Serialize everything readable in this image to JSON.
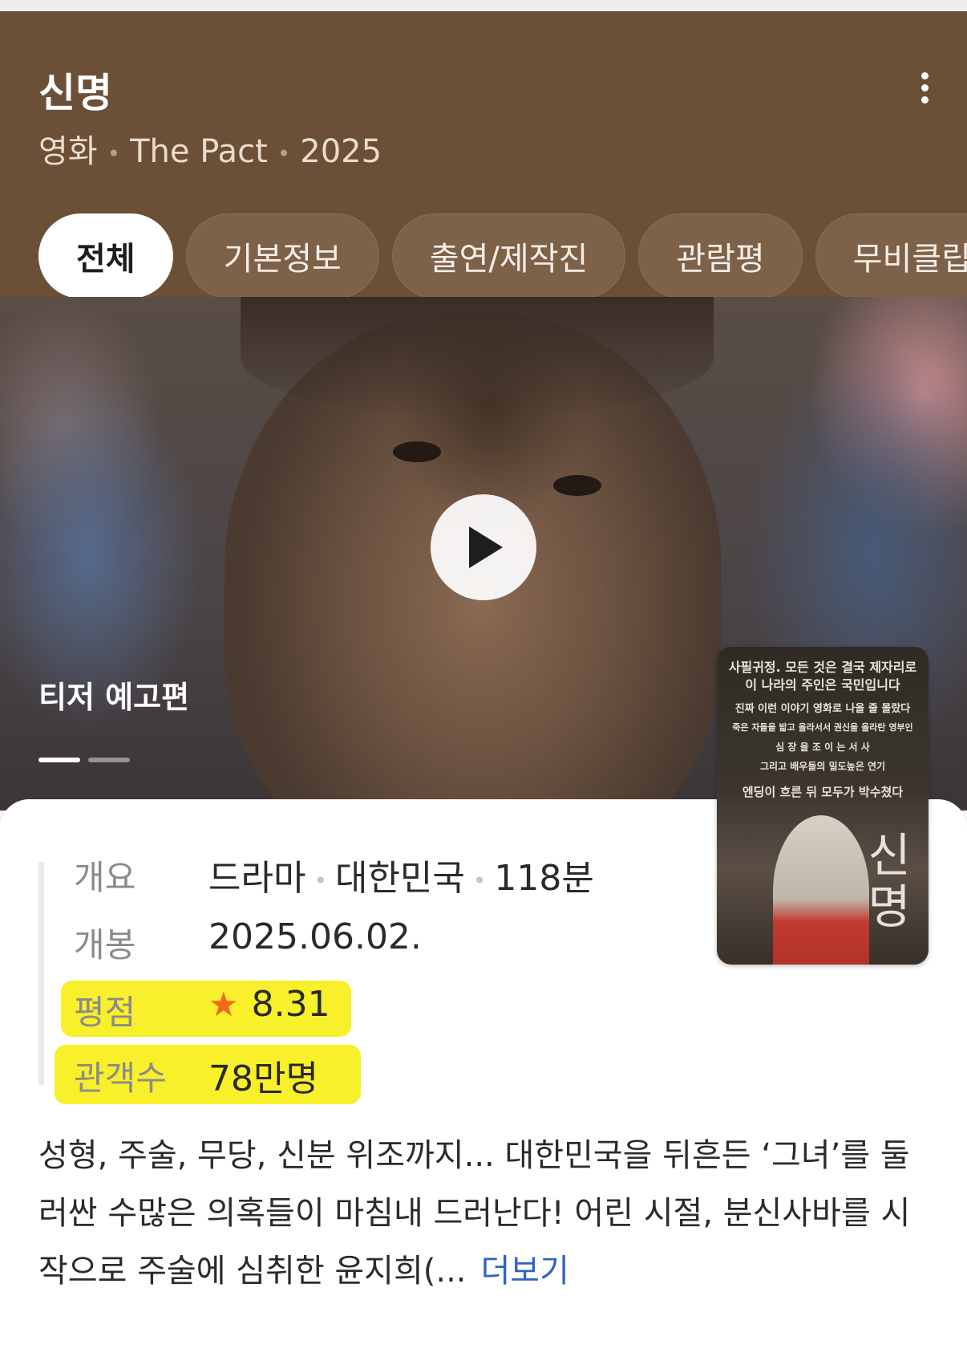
{
  "header": {
    "title": "신명",
    "subtitle_parts": [
      "영화",
      "The Pact",
      "2025"
    ]
  },
  "tabs": [
    {
      "label": "전체",
      "active": true
    },
    {
      "label": "기본정보",
      "active": false
    },
    {
      "label": "출연/제작진",
      "active": false
    },
    {
      "label": "관람평",
      "active": false
    },
    {
      "label": "무비클립",
      "active": false
    }
  ],
  "video": {
    "label": "티저 예고편",
    "slides_total": 2,
    "current_slide": 1
  },
  "poster": {
    "lines": [
      "사필귀정. 모든 것은 결국 제자리로",
      "이 나라의 주인은 국민입니다",
      "진짜 이런 이야기 영화로 나올 줄 몰랐다",
      "죽은 자들을 밟고 올라서서 권신을 올라탄 영부인",
      "심 장 을  조 이 는  서 사",
      "그리고 배우들의 밀도높은 연기",
      "엔딩이 흐른 뒤 모두가 박수쳤다"
    ],
    "title": "신명"
  },
  "info": {
    "overview": {
      "label": "개요",
      "genre": "드라마",
      "country": "대한민국",
      "runtime": "118분"
    },
    "release": {
      "label": "개봉",
      "value": "2025.06.02."
    },
    "rating": {
      "label": "평점",
      "value": "8.31",
      "star": "★"
    },
    "audience": {
      "label": "관객수",
      "value": "78만명"
    }
  },
  "synopsis": {
    "text": "성형, 주술, 무당, 신분 위조까지... 대한민국을 뒤흔든 ‘그녀’를 둘러싼 수많은 의혹들이 마침내 드러난다! 어린 시절, 분신사바를 시작으로 주술에 심취한 윤지희(...",
    "more_label": "더보기"
  },
  "colors": {
    "header_bg": "#6b4f36",
    "highlight": "#f7f02a",
    "star": "#f06a1a",
    "link": "#2f63c7"
  }
}
